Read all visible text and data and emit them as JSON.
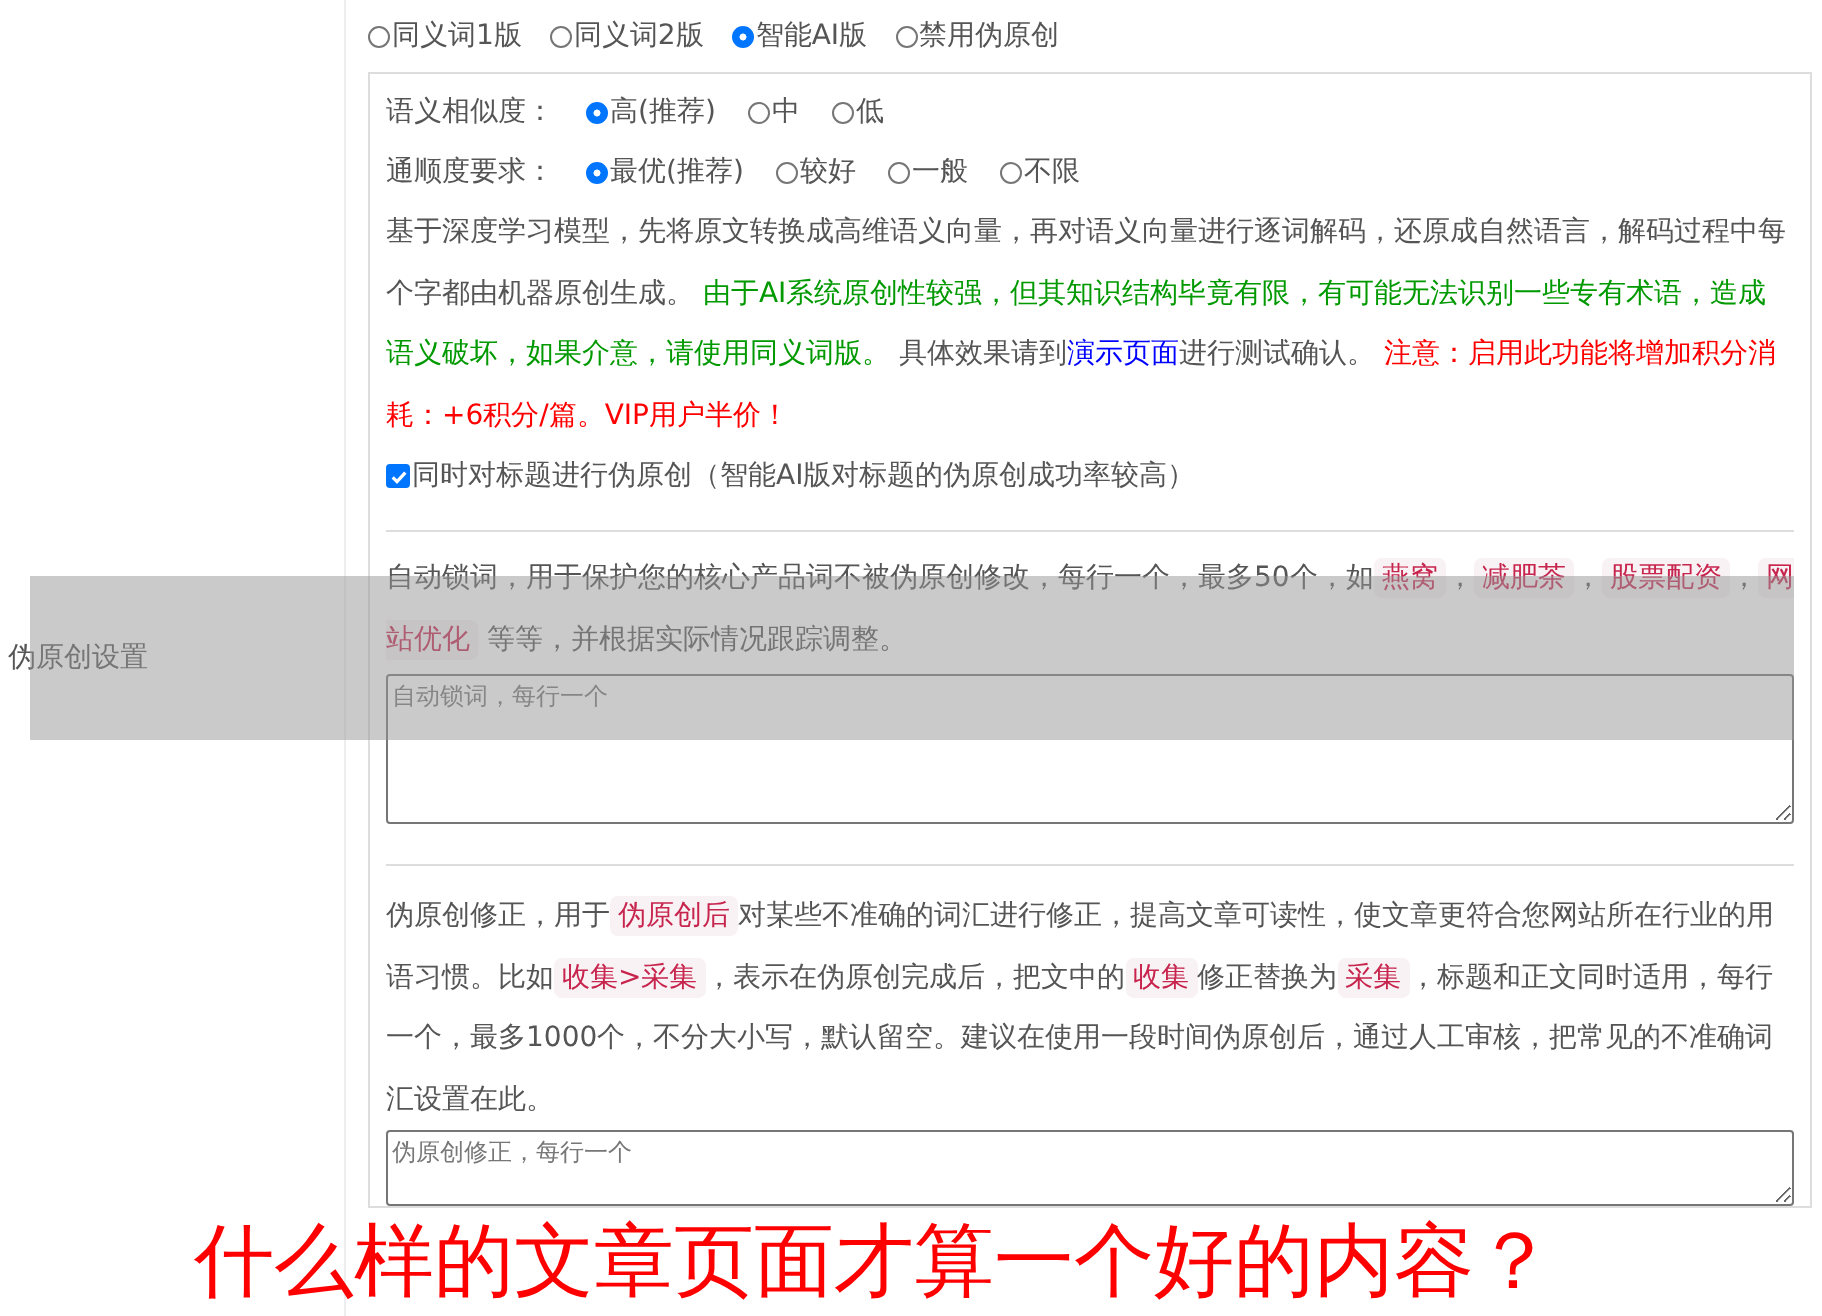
{
  "mode_options": [
    {
      "label": "同义词1版",
      "selected": false
    },
    {
      "label": "同义词2版",
      "selected": false
    },
    {
      "label": "智能AI版",
      "selected": true
    },
    {
      "label": "禁用伪原创",
      "selected": false
    }
  ],
  "similarity": {
    "label": "语义相似度：",
    "options": [
      {
        "label": "高(推荐)",
        "selected": true
      },
      {
        "label": "中",
        "selected": false
      },
      {
        "label": "低",
        "selected": false
      }
    ]
  },
  "fluency": {
    "label": "通顺度要求：",
    "options": [
      {
        "label": "最优(推荐)",
        "selected": true
      },
      {
        "label": "较好",
        "selected": false
      },
      {
        "label": "一般",
        "selected": false
      },
      {
        "label": "不限",
        "selected": false
      }
    ]
  },
  "description": [
    {
      "kind": "plain",
      "text": "基于深度学习模型，先将原文转换成高维语义向量，再对语义向量进行逐词解码，还原成自然语言，解码过程中每个字都由机器原创生成。 "
    },
    {
      "kind": "green",
      "text": "由于AI系统原创性较强，但其知识结构毕竟有限，有可能无法识别一些专有术语，造成语义破坏，如果介意，请使用同义词版。"
    },
    {
      "kind": "plain",
      "text": " 具体效果请到"
    },
    {
      "kind": "link",
      "text": "演示页面"
    },
    {
      "kind": "plain",
      "text": "进行测试确认。 "
    },
    {
      "kind": "red",
      "text": "注意：启用此功能将增加积分消耗：+6积分/篇。VIP用户半价！"
    }
  ],
  "title_option": {
    "label": "同时对标题进行伪原创（智能AI版对标题的伪原创成功率较高）",
    "checked": true
  },
  "section_label": "伪原创设置",
  "lock_words": {
    "description": [
      {
        "kind": "plain",
        "text": "自动锁词，用于保护您的核心产品词不被伪原创修改，每行一个，最多50个，如"
      },
      {
        "kind": "code",
        "text": "燕窝"
      },
      {
        "kind": "plain",
        "text": "，"
      },
      {
        "kind": "code",
        "text": "减肥茶"
      },
      {
        "kind": "plain",
        "text": "，"
      },
      {
        "kind": "code",
        "text": "股票配资"
      },
      {
        "kind": "plain",
        "text": "，"
      },
      {
        "kind": "code",
        "text": "网站优化"
      },
      {
        "kind": "plain",
        "text": " 等等，并根据实际情况跟踪调整。"
      }
    ],
    "placeholder": "自动锁词，每行一个"
  },
  "correction": {
    "description": [
      {
        "kind": "plain",
        "text": "伪原创修正，用于"
      },
      {
        "kind": "code",
        "text": "伪原创后"
      },
      {
        "kind": "plain",
        "text": "对某些不准确的词汇进行修正，提高文章可读性，使文章更符合您网站所在行业的用语习惯。比如"
      },
      {
        "kind": "code",
        "text": "收集>采集"
      },
      {
        "kind": "plain",
        "text": "，表示在伪原创完成后，把文中的"
      },
      {
        "kind": "code",
        "text": "收集"
      },
      {
        "kind": "plain",
        "text": "修正替换为"
      },
      {
        "kind": "code",
        "text": "采集"
      },
      {
        "kind": "plain",
        "text": "，标题和正文同时适用，每行一个，最多1000个，不分大小写，默认留空。建议在使用一段时间伪原创后，通过人工审核，把常见的不准确词汇设置在此。"
      }
    ],
    "placeholder": "伪原创修正，每行一个"
  },
  "caption": "什么样的文章页面才算一个好的内容？"
}
